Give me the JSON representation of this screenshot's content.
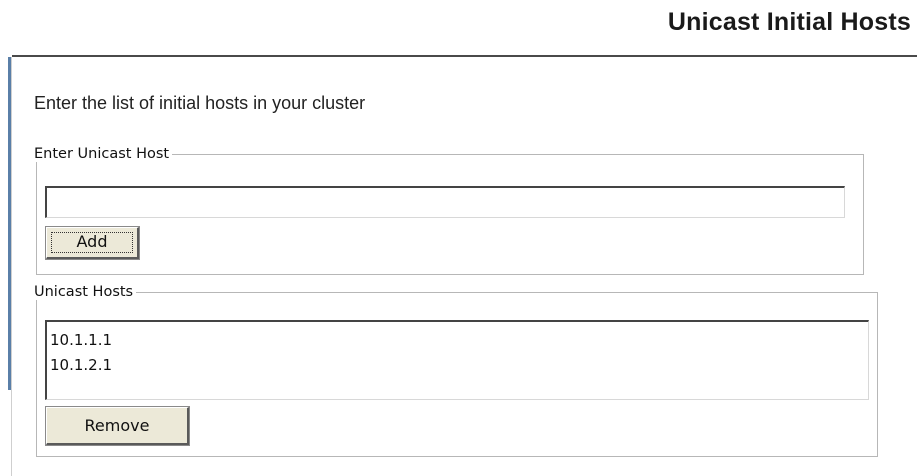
{
  "page": {
    "title": "Unicast Initial Hosts",
    "intro": "Enter the list of initial hosts in your cluster"
  },
  "enter_group": {
    "legend": "Enter Unicast Host",
    "input_value": "",
    "add_label": "Add"
  },
  "hosts_group": {
    "legend": "Unicast Hosts",
    "hosts": [
      "10.1.1.1",
      "10.1.2.1"
    ],
    "remove_label": "Remove"
  },
  "colors": {
    "left_accent": "#5a7fa8",
    "button_face": "#ece9d8"
  }
}
